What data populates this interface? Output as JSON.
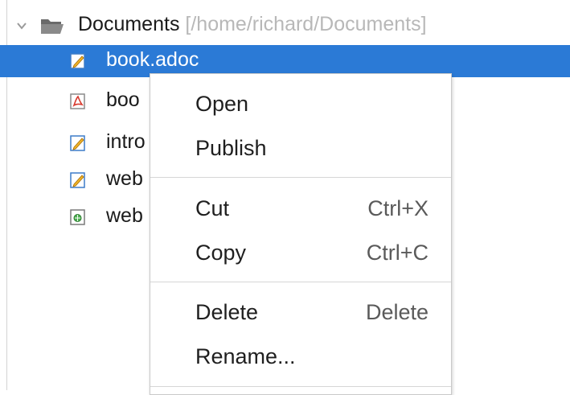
{
  "tree": {
    "folder": {
      "name": "Documents",
      "path": "[/home/richard/Documents]",
      "icon": "folder-icon",
      "expander_icon": "chevron-down-icon"
    },
    "files": [
      {
        "label": "book.adoc",
        "icon": "edit-document-icon",
        "selected": true
      },
      {
        "label": "boo",
        "icon": "pdf-icon",
        "selected": false
      },
      {
        "label": "intro",
        "icon": "edit-document-icon",
        "selected": false
      },
      {
        "label": "web",
        "icon": "edit-document-icon",
        "selected": false
      },
      {
        "label": "web",
        "icon": "web-document-icon",
        "selected": false
      }
    ]
  },
  "context_menu": {
    "items": [
      {
        "label": "Open",
        "shortcut": ""
      },
      {
        "label": "Publish",
        "shortcut": ""
      },
      {
        "label": "Cut",
        "shortcut": "Ctrl+X"
      },
      {
        "label": "Copy",
        "shortcut": "Ctrl+C"
      },
      {
        "label": "Delete",
        "shortcut": "Delete"
      },
      {
        "label": "Rename...",
        "shortcut": ""
      }
    ]
  },
  "colors": {
    "selection": "#2b7ad6",
    "path_text": "#b8b8b8",
    "pdf_red": "#d83a2f",
    "edit_blue": "#3d7cc9",
    "edit_pencil": "#f0b429"
  }
}
